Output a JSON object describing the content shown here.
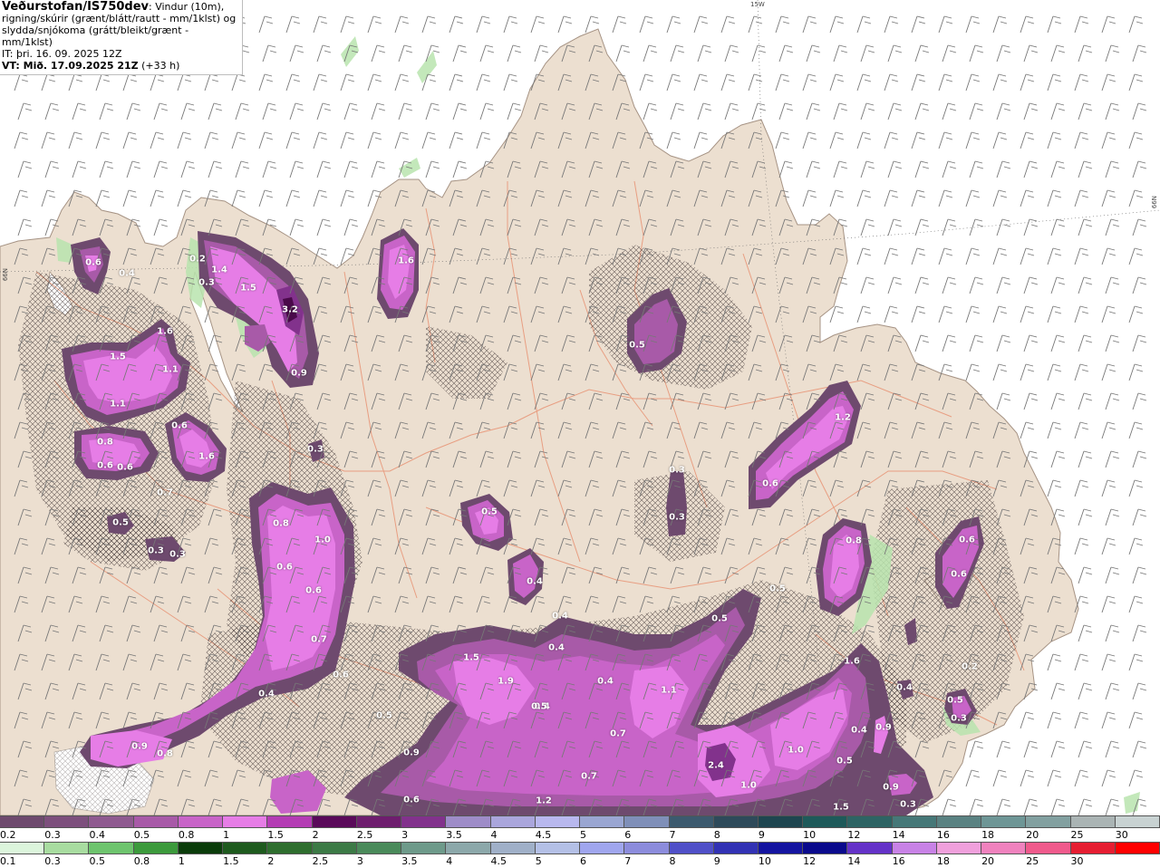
{
  "header": {
    "model": "Veðurstofan/IS750dev",
    "description_line1": ": Vindur (10m),",
    "description_line2": "rigning/skúrir (grænt/blátt/rautt - mm/1klst) og",
    "description_line3": "slydda/snjókoma (grátt/bleikt/grænt - mm/1klst)",
    "init_time": "IT: þri. 16. 09. 2025 12Z",
    "valid_time_label": "VT: Mið. 17.09.2025 21Z",
    "lead_time": "(+33 h)"
  },
  "grid_labels": {
    "lon_15w": "15W",
    "lat_66n_left": "66N",
    "lat_66n_right": "66N"
  },
  "map_labels": [
    "0.6",
    "0.4",
    "0.2",
    "1.4",
    "1.5",
    "0.3",
    "3.2",
    "1.6",
    "0.9",
    "1.6",
    "1.5",
    "1.1",
    "1.1",
    "0.8",
    "0.6",
    "0.6",
    "0.6",
    "1.6",
    "0.7",
    "0.5",
    "0.3",
    "0.3",
    "0.5",
    "0.3",
    "0.8",
    "1.0",
    "0.6",
    "0.6",
    "0.7",
    "0.6",
    "0.4",
    "0.5",
    "0.5",
    "0.4",
    "0.3",
    "0.3",
    "0.5",
    "1.2",
    "0.6",
    "0.8",
    "0.6",
    "0.6",
    "1.5",
    "1.9",
    "0.4",
    "0.4",
    "0.4",
    "1.1",
    "0.5",
    "0.4",
    "0.5",
    "0.9",
    "0.8",
    "0.9",
    "0.7",
    "0.7",
    "2.4",
    "1.0",
    "1.0",
    "1.2",
    "0.6",
    "1.6",
    "0.4",
    "0.9",
    "0.5",
    "0.4",
    "0.5",
    "0.2",
    "0.9",
    "0.3",
    "1.5",
    "0.3"
  ],
  "legend_top": {
    "label": "slydda/snjókoma",
    "ticks": [
      "0.2",
      "0.3",
      "0.4",
      "0.5",
      "0.8",
      "1",
      "1.5",
      "2",
      "2.5",
      "3",
      "3.5",
      "4",
      "4.5",
      "5",
      "6",
      "7",
      "8",
      "9",
      "10",
      "12",
      "14",
      "16",
      "18",
      "20",
      "25",
      "30"
    ],
    "colors": [
      "#6e4a6e",
      "#7d4f7d",
      "#8f5a90",
      "#a85aa8",
      "#c864c8",
      "#e67de6",
      "#b43cb4",
      "#5a0a5a",
      "#6e1e6e",
      "#82328c",
      "#9e8cc8",
      "#aaa6dc",
      "#b8b8ee",
      "#9aa6d2",
      "#7f8fb8",
      "#3c5a6e",
      "#2e4a5a",
      "#1e4650",
      "#1e5a5a",
      "#2e6464",
      "#467878",
      "#5a8282",
      "#6e9696",
      "#82a0a0",
      "#aab4b4",
      "#c8d2d2"
    ]
  },
  "legend_bottom": {
    "label": "rigning/skúrir",
    "ticks": [
      "0.1",
      "0.3",
      "0.5",
      "0.8",
      "1",
      "1.5",
      "2",
      "2.5",
      "3",
      "3.5",
      "4",
      "4.5",
      "5",
      "6",
      "7",
      "8",
      "9",
      "10",
      "12",
      "14",
      "16",
      "18",
      "20",
      "25",
      "30"
    ],
    "colors": [
      "#dcf5dc",
      "#a8dca0",
      "#6ec46e",
      "#3c9a3c",
      "#0a3c0a",
      "#1e5a1e",
      "#2e6e2e",
      "#3c7a46",
      "#4a8a5a",
      "#6e9a8a",
      "#8ca8aa",
      "#a0b0c8",
      "#b4c0e6",
      "#a0a6ee",
      "#8c8cdc",
      "#5050c8",
      "#3232b4",
      "#1414a0",
      "#0a0a8c",
      "#6432c8",
      "#c882e6",
      "#f0a0dc",
      "#f082be",
      "#f05a8c",
      "#e61e32",
      "#ff0000"
    ]
  }
}
